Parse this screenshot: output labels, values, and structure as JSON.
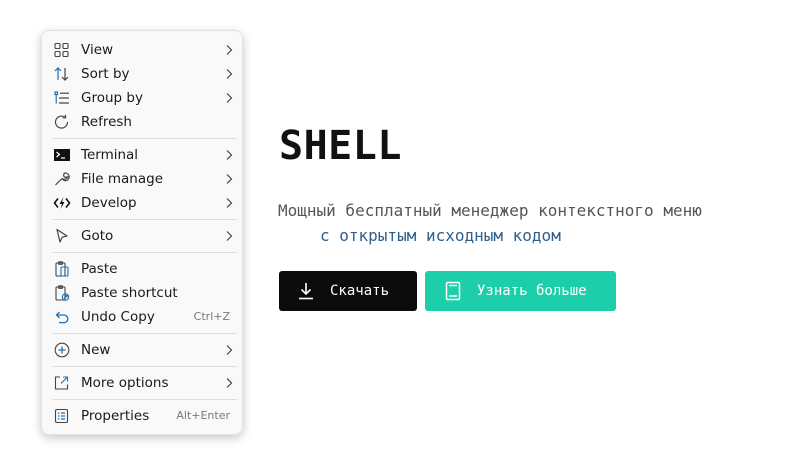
{
  "menu": {
    "items": [
      {
        "label": "View",
        "icon": "grid-icon"
      },
      {
        "label": "Sort by",
        "icon": "sort-icon"
      },
      {
        "label": "Group by",
        "icon": "group-icon"
      },
      {
        "label": "Refresh",
        "icon": "refresh-icon"
      },
      {
        "label": "Terminal",
        "icon": "terminal-icon"
      },
      {
        "label": "File manage",
        "icon": "wrench-icon"
      },
      {
        "label": "Develop",
        "icon": "develop-icon"
      },
      {
        "label": "Goto",
        "icon": "cursor-icon"
      },
      {
        "label": "Paste",
        "icon": "clipboard-icon"
      },
      {
        "label": "Paste shortcut",
        "icon": "paste-shortcut-icon"
      },
      {
        "label": "Undo Copy",
        "icon": "undo-icon",
        "shortcut": "Ctrl+Z"
      },
      {
        "label": "New",
        "icon": "plus-circle-icon"
      },
      {
        "label": "More options",
        "icon": "open-external-icon"
      },
      {
        "label": "Properties",
        "icon": "properties-icon",
        "shortcut": "Alt+Enter"
      }
    ]
  },
  "hero": {
    "title": "SHELL",
    "subtitle_line1": "Мощный бесплатный менеджер контекстного меню",
    "subtitle_line2": "с открытым исходным кодом",
    "download_label": "Скачать",
    "learn_more_label": "Узнать больше"
  },
  "colors": {
    "accent_teal": "#1ccfaa",
    "download_bg": "#0b0b0b",
    "subtitle_link": "#2f5f8a",
    "icon_blue": "#1f6fb5"
  }
}
